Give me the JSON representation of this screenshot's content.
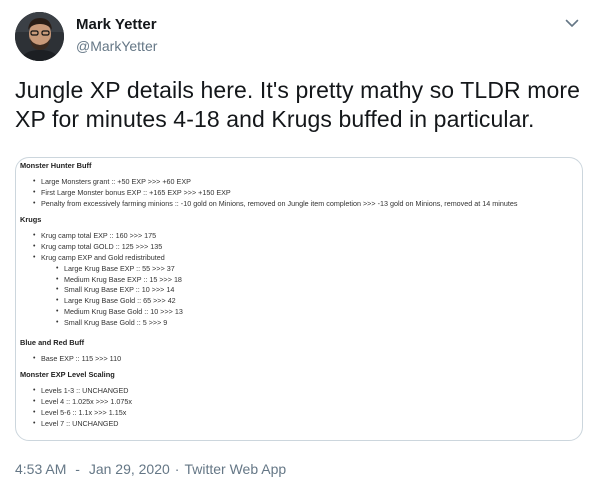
{
  "author": {
    "name": "Mark Yetter",
    "handle": "@MarkYetter"
  },
  "icons": {
    "avatar": "profile-photo",
    "caret": "chevron-down-icon"
  },
  "tweet_text": "Jungle XP details here. It's pretty mathy so TLDR more XP for minutes 4-18 and Krugs buffed in particular.",
  "image": {
    "sections": [
      {
        "title": "Monster Hunter Buff",
        "items": [
          {
            "text": "Large Monsters grant :: +50 EXP >>> +60 EXP"
          },
          {
            "text": "First Large Monster bonus EXP :: +165 EXP >>> +150 EXP"
          },
          {
            "text": "Penalty from excessively farming minions :: -10 gold on Minions, removed on Jungle item completion >>> -13 gold on Minions, removed at 14 minutes"
          }
        ]
      },
      {
        "title": "Krugs",
        "items": [
          {
            "text": "Krug camp total EXP :: 160 >>> 175"
          },
          {
            "text": "Krug camp total GOLD :: 125 >>> 135"
          },
          {
            "text": "Krug camp EXP and Gold redistributed"
          },
          {
            "text": "Large Krug Base EXP :: 55 >>> 37",
            "sub": true
          },
          {
            "text": "Medium Krug Base EXP :: 15 >>> 18",
            "sub": true
          },
          {
            "text": "Small Krug Base EXP :: 10 >>> 14",
            "sub": true
          },
          {
            "text": "Large Krug Base Gold :: 65 >>> 42",
            "sub": true
          },
          {
            "text": "Medium Krug Base Gold :: 10 >>> 13",
            "sub": true
          },
          {
            "text": "Small Krug Base Gold :: 5 >>> 9",
            "sub": true
          }
        ]
      },
      {
        "title": "Blue and Red Buff",
        "items": [
          {
            "text": "Base EXP :: 115 >>> 110"
          }
        ]
      },
      {
        "title": "Monster EXP Level Scaling",
        "items": [
          {
            "text": "Levels 1-3 :: UNCHANGED"
          },
          {
            "text": "Level 4 :: 1.025x >>> 1.075x"
          },
          {
            "text": "Level 5-6 :: 1.1x >>> 1.15x"
          },
          {
            "text": "Level 7 :: UNCHANGED"
          }
        ]
      }
    ]
  },
  "meta": {
    "time": "4:53 AM",
    "separator": "·",
    "date": "Jan 29, 2020",
    "source": "Twitter Web App"
  },
  "colors": {
    "text_primary": "#14171a",
    "text_secondary": "#657786",
    "border": "#ccd6dd"
  }
}
